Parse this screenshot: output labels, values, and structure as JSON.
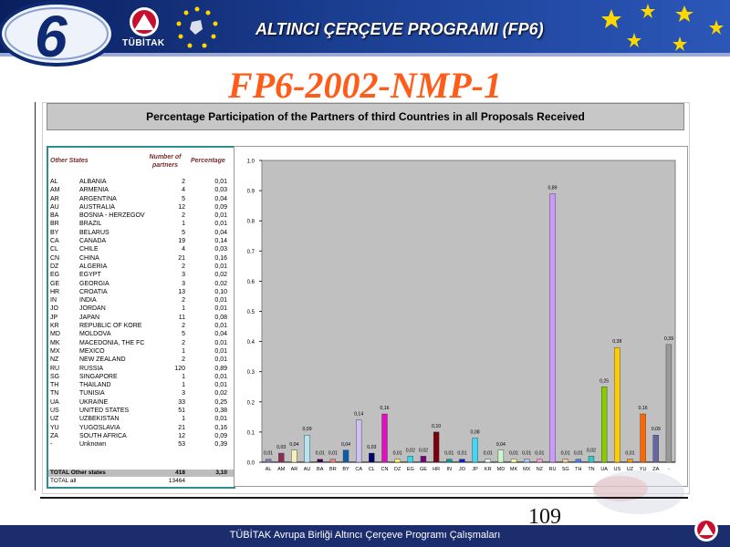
{
  "banner": {
    "title": "ALTINCI ÇERÇEVE PROGRAMI (FP6)",
    "logo_numeral": "6",
    "org_name": "TÜBİTAK"
  },
  "slide": {
    "title": "FP6-2002-NMP-1",
    "page_number": "109"
  },
  "footer": {
    "text": "TÜBİTAK Avrupa Birliği Altıncı Çerçeve Programı Çalışmaları"
  },
  "colors": {
    "banner": "#0b1f5e",
    "title_orange": "#ff5c1a",
    "footer": "#1c2d6e",
    "table_border": "#2b8f8f",
    "plot_bg": "#c0c0c0"
  },
  "table": {
    "col_other_states": "Other States",
    "col_number": "Number of partners",
    "col_percentage": "Percentage",
    "rows": [
      {
        "code": "AL",
        "name": "ALBANIA",
        "n": "2",
        "pct": "0,01"
      },
      {
        "code": "AM",
        "name": "ARMENIA",
        "n": "4",
        "pct": "0,03"
      },
      {
        "code": "AR",
        "name": "ARGENTINA",
        "n": "5",
        "pct": "0,04"
      },
      {
        "code": "AU",
        "name": "AUSTRALIA",
        "n": "12",
        "pct": "0,09"
      },
      {
        "code": "BA",
        "name": "BOSNIA - HERZEGOV",
        "n": "2",
        "pct": "0,01"
      },
      {
        "code": "BR",
        "name": "BRAZIL",
        "n": "1",
        "pct": "0,01"
      },
      {
        "code": "BY",
        "name": "BELARUS",
        "n": "5",
        "pct": "0,04"
      },
      {
        "code": "CA",
        "name": "CANADA",
        "n": "19",
        "pct": "0,14"
      },
      {
        "code": "CL",
        "name": "CHILE",
        "n": "4",
        "pct": "0,03"
      },
      {
        "code": "CN",
        "name": "CHINA",
        "n": "21",
        "pct": "0,16"
      },
      {
        "code": "DZ",
        "name": "ALGERIA",
        "n": "2",
        "pct": "0,01"
      },
      {
        "code": "EG",
        "name": "EGYPT",
        "n": "3",
        "pct": "0,02"
      },
      {
        "code": "GE",
        "name": "GEORGIA",
        "n": "3",
        "pct": "0,02"
      },
      {
        "code": "HR",
        "name": "CROATIA",
        "n": "13",
        "pct": "0,10"
      },
      {
        "code": "IN",
        "name": "INDIA",
        "n": "2",
        "pct": "0,01"
      },
      {
        "code": "JO",
        "name": "JORDAN",
        "n": "1",
        "pct": "0,01"
      },
      {
        "code": "JP",
        "name": "JAPAN",
        "n": "11",
        "pct": "0,08"
      },
      {
        "code": "KR",
        "name": "REPUBLIC OF KORE",
        "n": "2",
        "pct": "0,01"
      },
      {
        "code": "MD",
        "name": "MOLDOVA",
        "n": "5",
        "pct": "0,04"
      },
      {
        "code": "MK",
        "name": "MACEDONIA, THE FC",
        "n": "2",
        "pct": "0,01"
      },
      {
        "code": "MX",
        "name": "MEXICO",
        "n": "1",
        "pct": "0,01"
      },
      {
        "code": "NZ",
        "name": "NEW ZEALAND",
        "n": "2",
        "pct": "0,01"
      },
      {
        "code": "RU",
        "name": "RUSSIA",
        "n": "120",
        "pct": "0,89"
      },
      {
        "code": "SG",
        "name": "SINGAPORE",
        "n": "1",
        "pct": "0,01"
      },
      {
        "code": "TH",
        "name": "THAILAND",
        "n": "1",
        "pct": "0,01"
      },
      {
        "code": "TN",
        "name": "TUNISIA",
        "n": "3",
        "pct": "0,02"
      },
      {
        "code": "UA",
        "name": "UKRAINE",
        "n": "33",
        "pct": "0,25"
      },
      {
        "code": "US",
        "name": "UNITED STATES",
        "n": "51",
        "pct": "0,38"
      },
      {
        "code": "UZ",
        "name": "UZBEKISTAN",
        "n": "1",
        "pct": "0,01"
      },
      {
        "code": "YU",
        "name": "YUGOSLAVIA",
        "n": "21",
        "pct": "0,16"
      },
      {
        "code": "ZA",
        "name": "SOUTH AFRICA",
        "n": "12",
        "pct": "0,09"
      },
      {
        "code": "-",
        "name": "Unknown",
        "n": "53",
        "pct": "0,39"
      }
    ],
    "total_label": "TOTAL Other states",
    "total_n": "418",
    "total_pct": "3,10",
    "total_all_label": "TOTAL all",
    "total_all_n": "13464"
  },
  "chart_data": {
    "type": "bar",
    "title": "Percentage Participation of the Partners of third Countries in all Proposals Received",
    "categories": [
      "AL",
      "AM",
      "AR",
      "AU",
      "BA",
      "BR",
      "BY",
      "CA",
      "CL",
      "CN",
      "DZ",
      "EG",
      "GE",
      "HR",
      "IN",
      "JO",
      "JP",
      "KR",
      "MD",
      "MK",
      "MX",
      "NZ",
      "RU",
      "SG",
      "TH",
      "TN",
      "UA",
      "US",
      "UZ",
      "YU",
      "ZA",
      "-"
    ],
    "values": [
      0.01,
      0.03,
      0.04,
      0.09,
      0.01,
      0.01,
      0.04,
      0.14,
      0.03,
      0.16,
      0.01,
      0.02,
      0.02,
      0.1,
      0.01,
      0.01,
      0.08,
      0.01,
      0.04,
      0.01,
      0.01,
      0.01,
      0.89,
      0.01,
      0.01,
      0.02,
      0.25,
      0.38,
      0.01,
      0.16,
      0.09,
      0.39
    ],
    "value_labels": [
      "0,01",
      "0,03",
      "0,04",
      "0,09",
      "0,01",
      "0,01",
      "0,04",
      "0,14",
      "0,03",
      "0,16",
      "0,01",
      "0,02",
      "0,02",
      "0,10",
      "0,01",
      "0,01",
      "0,08",
      "0,01",
      "0,04",
      "0,01",
      "0,01",
      "0,01",
      "0,89",
      "0,01",
      "0,01",
      "0,02",
      "0,25",
      "0,38",
      "0,01",
      "0,16",
      "0,09",
      "0,39"
    ],
    "colors": [
      "#7d7db8",
      "#8b2d56",
      "#f5f0b8",
      "#b3e6f0",
      "#4a0050",
      "#f08080",
      "#0c5ca8",
      "#cdc2f0",
      "#00006e",
      "#e00fc0",
      "#fff066",
      "#30d8f0",
      "#7a0080",
      "#7a0010",
      "#00a0a0",
      "#0020e0",
      "#40d8f8",
      "#d8f8f8",
      "#cdf8cd",
      "#ffff99",
      "#a8c8ff",
      "#ff99cc",
      "#cc99ff",
      "#ffcc99",
      "#4a7cf8",
      "#30c8c8",
      "#88cc00",
      "#ffcc00",
      "#ff9900",
      "#ff6600",
      "#6666a0",
      "#999999"
    ],
    "ylim": [
      0,
      1.0
    ],
    "yticks": [
      "0.0",
      "0.1",
      "0.2",
      "0.3",
      "0.4",
      "0.5",
      "0.6",
      "0.7",
      "0.8",
      "0.9",
      "1.0"
    ],
    "grid": false,
    "xlabel": "",
    "ylabel": ""
  }
}
